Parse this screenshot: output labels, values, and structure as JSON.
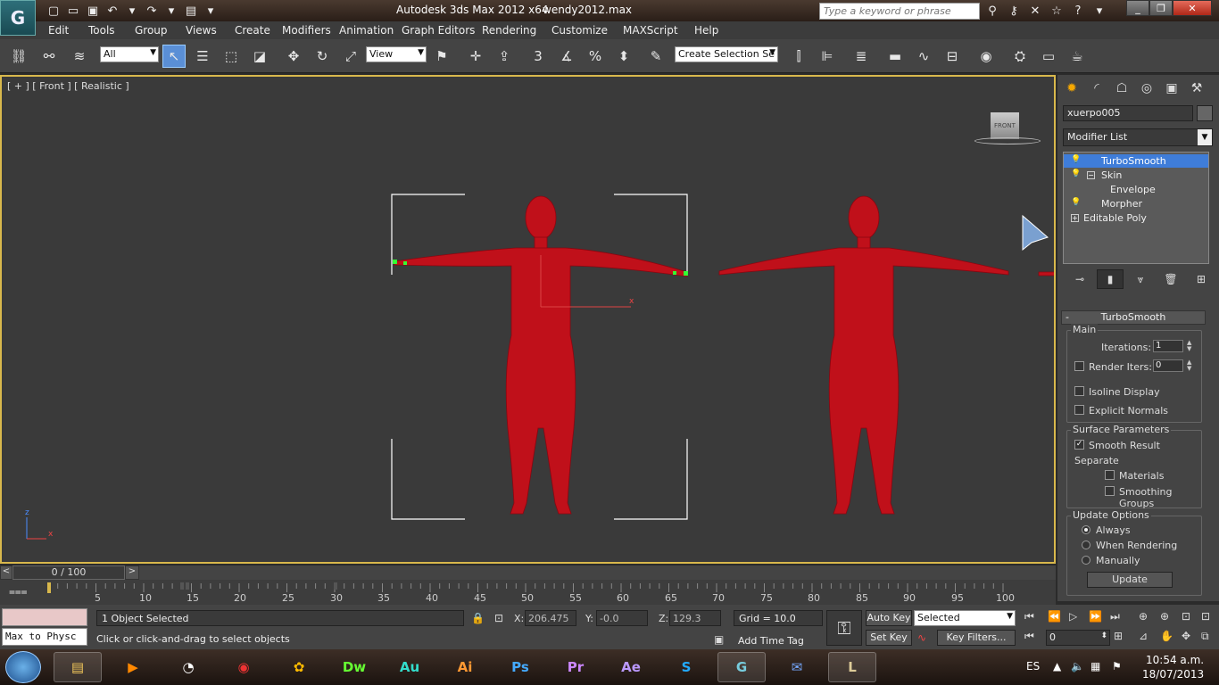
{
  "titlebar": {
    "app_title": "Autodesk 3ds Max  2012 x64",
    "file_name": "wendy2012.max",
    "search_placeholder": "Type a keyword or phrase"
  },
  "menu": [
    "Edit",
    "Tools",
    "Group",
    "Views",
    "Create",
    "Modifiers",
    "Animation",
    "Graph Editors",
    "Rendering",
    "Customize",
    "MAXScript",
    "Help"
  ],
  "toolbar": {
    "filter_value": "All",
    "ref_coord_value": "View",
    "named_selection_value": "Create Selection Se"
  },
  "viewport": {
    "label": "[ + ] [ Front ] [ Realistic ]",
    "viewcube_face": "FRONT",
    "axis_z": "z",
    "axis_x": "x"
  },
  "command_panel": {
    "object_name": "xuerpo005",
    "modifier_list": "Modifier List",
    "stack": [
      {
        "label": "TurboSmooth",
        "selected": true
      },
      {
        "label": "Skin",
        "selected": false
      },
      {
        "label": "Envelope",
        "selected": false
      },
      {
        "label": "Morpher",
        "selected": false
      },
      {
        "label": "Editable Poly",
        "selected": false
      }
    ],
    "rollout_title": "TurboSmooth",
    "main_group": "Main",
    "iterations_label": "Iterations:",
    "iterations_value": "1",
    "render_iters_label": "Render Iters:",
    "render_iters_value": "0",
    "isoline_label": "Isoline Display",
    "explicit_normals_label": "Explicit Normals",
    "surface_group": "Surface Parameters",
    "smooth_result_label": "Smooth Result",
    "separate_label": "Separate",
    "materials_label": "Materials",
    "smoothing_groups_label": "Smoothing Groups",
    "update_group": "Update Options",
    "always_label": "Always",
    "when_rendering_label": "When Rendering",
    "manually_label": "Manually",
    "update_button": "Update"
  },
  "timeline": {
    "frame_display": "0 / 100",
    "left_arrow": "<",
    "right_arrow": ">",
    "ticks": [
      "5",
      "10",
      "15",
      "20",
      "25",
      "30",
      "35",
      "40",
      "45",
      "50",
      "55",
      "60",
      "65",
      "70",
      "75",
      "80",
      "85",
      "90",
      "95",
      "100"
    ]
  },
  "status": {
    "listener_text": "Max to Physc",
    "selection_count": "1 Object Selected",
    "prompt": "Click or click-and-drag to select objects",
    "x_label": "X:",
    "x_value": "206.475",
    "y_label": "Y:",
    "y_value": "-0.0",
    "z_label": "Z:",
    "z_value": "129.3",
    "grid": "Grid = 10.0",
    "add_time_tag": "Add Time Tag",
    "auto_key": "Auto Key",
    "set_key": "Set Key",
    "selected_dropdown": "Selected",
    "key_filters": "Key Filters...",
    "frame_field": "0"
  },
  "taskbar": {
    "apps": [
      "Dw",
      "Au",
      "Ai",
      "Ps",
      "Pr",
      "Ae"
    ],
    "language": "ES",
    "time": "10:54 a.m.",
    "date": "18/07/2013"
  },
  "colors": {
    "viewport_border": "#d8b84c",
    "selection_blue": "#3f7dd9",
    "model_red": "#c0101a"
  }
}
